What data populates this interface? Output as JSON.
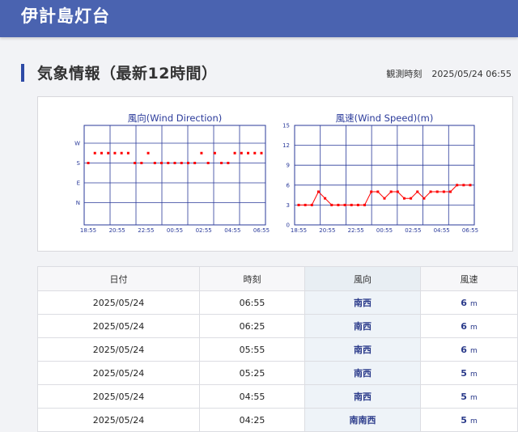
{
  "header": {
    "title": "伊計島灯台"
  },
  "section": {
    "title": "気象情報（最新12時間）",
    "obs_label": "観測時刻",
    "obs_time": "2025/05/24 06:55"
  },
  "chart_data": [
    {
      "type": "scatter",
      "title": "風向(Wind Direction)",
      "x_labels": [
        "18:55",
        "20:55",
        "22:55",
        "00:55",
        "02:55",
        "04:55",
        "06:55"
      ],
      "y_categories": [
        "N",
        "E",
        "S",
        "W"
      ],
      "y_points": [
        "南",
        "南西",
        "南西",
        "南西",
        "南西",
        "南西",
        "南西",
        "南",
        "南",
        "南西",
        "南",
        "南",
        "南",
        "南",
        "南",
        "南",
        "南",
        "南西",
        "南",
        "南西",
        "南",
        "南",
        "南西",
        "南西",
        "南西",
        "南西",
        "南西"
      ],
      "color": "#ff0000"
    },
    {
      "type": "line",
      "title": "風速(Wind Speed)(m)",
      "x_labels": [
        "18:55",
        "20:55",
        "22:55",
        "00:55",
        "02:55",
        "04:55",
        "06:55"
      ],
      "y_ticks": [
        "0",
        "3",
        "6",
        "9",
        "12",
        "15"
      ],
      "ylim": [
        0,
        15
      ],
      "values": [
        3,
        3,
        3,
        5,
        4,
        3,
        3,
        3,
        3,
        3,
        3,
        5,
        5,
        4,
        5,
        5,
        4,
        4,
        5,
        4,
        5,
        5,
        5,
        5,
        6,
        6,
        6
      ],
      "color": "#ff0000"
    }
  ],
  "table": {
    "headers": [
      "日付",
      "時刻",
      "風向",
      "風速"
    ],
    "unit": "m",
    "rows": [
      {
        "date": "2025/05/24",
        "time": "06:55",
        "dir": "南西",
        "speed": "6"
      },
      {
        "date": "2025/05/24",
        "time": "06:25",
        "dir": "南西",
        "speed": "6"
      },
      {
        "date": "2025/05/24",
        "time": "05:55",
        "dir": "南西",
        "speed": "6"
      },
      {
        "date": "2025/05/24",
        "time": "05:25",
        "dir": "南西",
        "speed": "5"
      },
      {
        "date": "2025/05/24",
        "time": "04:55",
        "dir": "南西",
        "speed": "5"
      },
      {
        "date": "2025/05/24",
        "time": "04:25",
        "dir": "南南西",
        "speed": "5"
      }
    ]
  }
}
